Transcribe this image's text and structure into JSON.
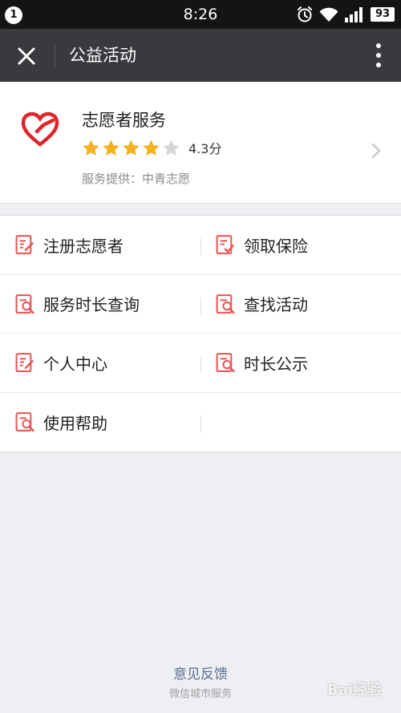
{
  "status_bar": {
    "notification_count": "1",
    "time": "8:26",
    "battery": "93",
    "icons": [
      "alarm-icon",
      "wifi-icon",
      "signal-icon"
    ]
  },
  "nav": {
    "title": "公益活动",
    "close_icon": "close-icon",
    "more_icon": "more-vertical-icon"
  },
  "service": {
    "name": "志愿者服务",
    "rating": 4.3,
    "rating_text": "4.3分",
    "stars_filled": 4,
    "stars_total": 5,
    "provider": "服务提供：中青志愿",
    "logo_icon": "heart-hand-icon",
    "accent": "#e0242b",
    "star_color": "#f5b120"
  },
  "menu": {
    "rows": [
      [
        {
          "label": "注册志愿者",
          "icon": "document-edit-icon"
        },
        {
          "label": "领取保险",
          "icon": "document-check-icon"
        }
      ],
      [
        {
          "label": "服务时长查询",
          "icon": "document-search-icon"
        },
        {
          "label": "查找活动",
          "icon": "document-search-icon"
        }
      ],
      [
        {
          "label": "个人中心",
          "icon": "document-edit-icon"
        },
        {
          "label": "时长公示",
          "icon": "document-search-icon"
        }
      ],
      [
        {
          "label": "使用帮助",
          "icon": "document-search-icon"
        }
      ]
    ],
    "icon_color": "#e85a5a"
  },
  "footer": {
    "feedback": "意见反馈",
    "subtitle": "微信城市服务"
  },
  "watermark": "Bai经验"
}
